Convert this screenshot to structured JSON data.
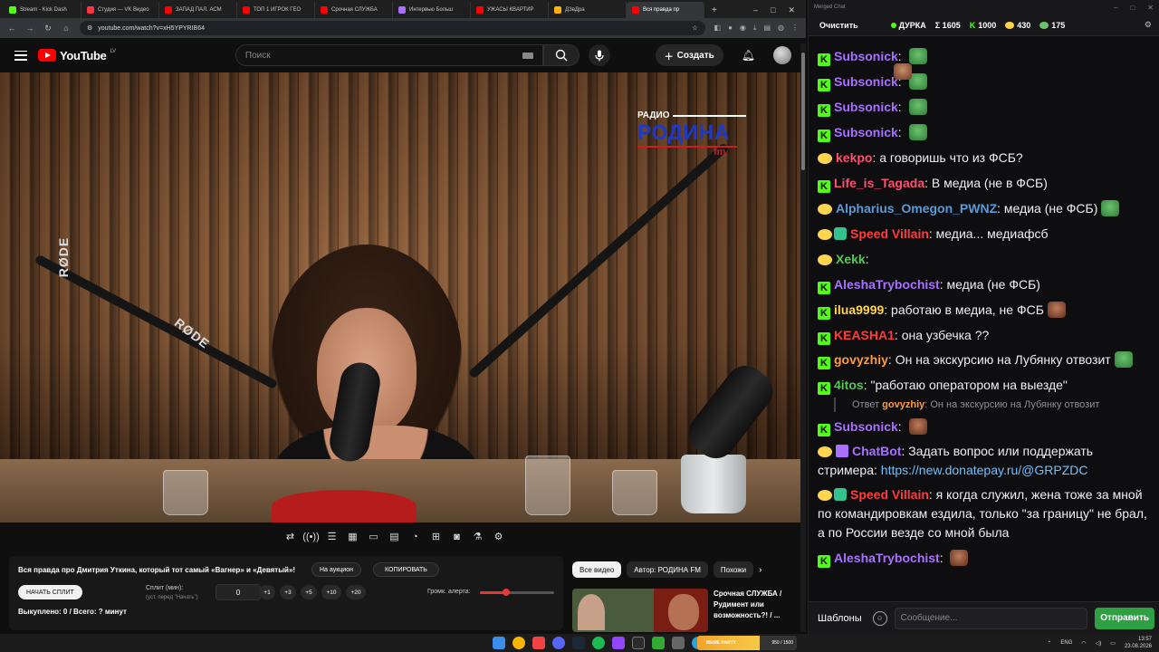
{
  "browser": {
    "tabs": [
      {
        "label": "Stream - Kick Dash",
        "color": "#53fc18"
      },
      {
        "label": "Студия — VK Видео",
        "color": "#ff3347"
      },
      {
        "label": "ЗАПАД ПАЛ. АСМ",
        "color": "#ff0000"
      },
      {
        "label": "ТОП 1 ИГРОК ГЕО",
        "color": "#ff0000"
      },
      {
        "label": "Срочная СЛУЖБА",
        "color": "#ff0000"
      },
      {
        "label": "Интервью Больш",
        "color": "#a970ff"
      },
      {
        "label": "УЖАСЫ КВАРТИР",
        "color": "#ff0000"
      },
      {
        "label": "ДЗвДра",
        "color": "#ffb300"
      },
      {
        "label": "Вся правда пр",
        "color": "#ff0000",
        "active": true
      }
    ],
    "new_tab": "+",
    "url": "youtube.com/watch?v=xH5YPYRIB64",
    "window_controls": [
      "–",
      "□",
      "✕"
    ]
  },
  "youtube": {
    "logo_text": "YouTube",
    "region": "LV",
    "search_placeholder": "Поиск",
    "create_label": "Создать"
  },
  "video_overlay": {
    "radio_small": "РАДИО",
    "radio_big": "РОДИНА",
    "radio_fm": "fm",
    "rode_left": "RØDE",
    "rode_right": "RØDE"
  },
  "panel": {
    "title": "Вся правда про Дмитрия Уткина, который тот самый «Вагнер» и «Девятый»!",
    "auction_btn": "На аукцион",
    "copy_btn": "КОПИРОВАТЬ",
    "start_split_btn": "НАЧАТЬ СПЛИТ",
    "split_label": "Сплит (мин):",
    "split_hint": "(уст. перед \"Начать\")",
    "split_value": "0",
    "steps": [
      "+1",
      "+3",
      "+5",
      "+10",
      "+20"
    ],
    "volume_label": "Громк. алерта:",
    "volume_fraction": 0.35,
    "bought": "Выкуплено: 0 / Всего: ? минут"
  },
  "related": {
    "tabs": [
      "Все видео",
      "Автор: РОДИНА FM",
      "Похожи"
    ],
    "card_title": "Срочная СЛУЖБА / Рудимент или возможность?! / ..."
  },
  "chat": {
    "window_title": "Merged Chat",
    "clear_btn": "Очистить",
    "channel": "ДУРКА",
    "sigma": "Σ 1605",
    "kick_count": "1000",
    "twitch_count": "430",
    "other_count": "175",
    "messages": [
      {
        "platform": "kick",
        "user": "Subsonick",
        "color": "#a970ff",
        "text": "",
        "emote": "frog"
      },
      {
        "platform": "kick",
        "user": "Subsonick",
        "color": "#a970ff",
        "text": "",
        "emote": "frog"
      },
      {
        "platform": "kick",
        "user": "Subsonick",
        "color": "#a970ff",
        "text": "",
        "emote": "frog"
      },
      {
        "platform": "kick",
        "user": "Subsonick",
        "color": "#a970ff",
        "text": "",
        "emote": "frog"
      },
      {
        "platform": "twitch",
        "user": "kekpo",
        "color": "#ff4f6e",
        "text": "а говоришь что из ФСБ?",
        "emote": ""
      },
      {
        "platform": "kick",
        "user": "Life_is_Tagada",
        "color": "#ff4f6e",
        "text": "В медиа (не в ФСБ)",
        "emote": ""
      },
      {
        "platform": "twitch",
        "user": "Alpharius_Omegon_PWNZ",
        "color": "#5a9ad6",
        "text": "медиа (не ФСБ)",
        "emote": "frog"
      },
      {
        "platform": "twitch-mod",
        "user": "Speed Villain",
        "color": "#ff3b3b",
        "text": "медиа... медиафсб",
        "emote": ""
      },
      {
        "platform": "twitch",
        "user": "Xekk",
        "color": "#53c753",
        "text": "",
        "emote": "face"
      },
      {
        "platform": "kick",
        "user": "AleshaTrybochist",
        "color": "#a970ff",
        "text": "медиа (не ФСБ)",
        "emote": ""
      },
      {
        "platform": "kick",
        "user": "ilua9999",
        "color": "#ffd54f",
        "text": "работаю в медиа, не ФСБ",
        "emote": "cat"
      },
      {
        "platform": "kick",
        "user": "KEASHA1",
        "color": "#ff3b3b",
        "text": "она узбечка ??",
        "emote": ""
      },
      {
        "platform": "kick",
        "user": "govyzhiy",
        "color": "#ff9b3b",
        "text": "Он на экскурсию на Лубянку отвозит",
        "emote": "frog",
        "wrap": true
      },
      {
        "platform": "kick",
        "user": "4itos",
        "color": "#53c753",
        "text": "\"работаю оператором на выезде\"",
        "emote": ""
      }
    ],
    "reply": {
      "label": "Ответ",
      "user": "govyzhiy",
      "text": "Он на экскурсию на Лубянку отвозит"
    },
    "messages2": [
      {
        "platform": "kick",
        "user": "Subsonick",
        "color": "#a970ff",
        "text": "",
        "emote": "cat"
      },
      {
        "platform": "twitch-bot",
        "user": "ChatBot",
        "color": "#a970ff",
        "text": "Задать вопрос или поддержать стримера: ",
        "link": "https://new.donatepay.ru/@GRPZDC",
        "wrap": true
      },
      {
        "platform": "twitch-mod",
        "user": "Speed Villain",
        "color": "#ff3b3b",
        "text": "я когда служил, жена тоже за мной по командировкам ездила, только \"за границу\" не брал, а по России везде со мной была",
        "wrap": true
      },
      {
        "platform": "kick",
        "user": "AleshaTrybochist",
        "color": "#a970ff",
        "text": "",
        "emote": "cat"
      }
    ],
    "templates_btn": "Шаблоны",
    "input_placeholder": "Сообщение...",
    "send_btn": "Отправить"
  },
  "taskbar": {
    "meme_label": "MEME PARTY",
    "meme_progress": "950 / 1500",
    "meme_fraction": 0.63,
    "lang": "ENG",
    "time": "13:57",
    "date": "23.08.2026"
  }
}
